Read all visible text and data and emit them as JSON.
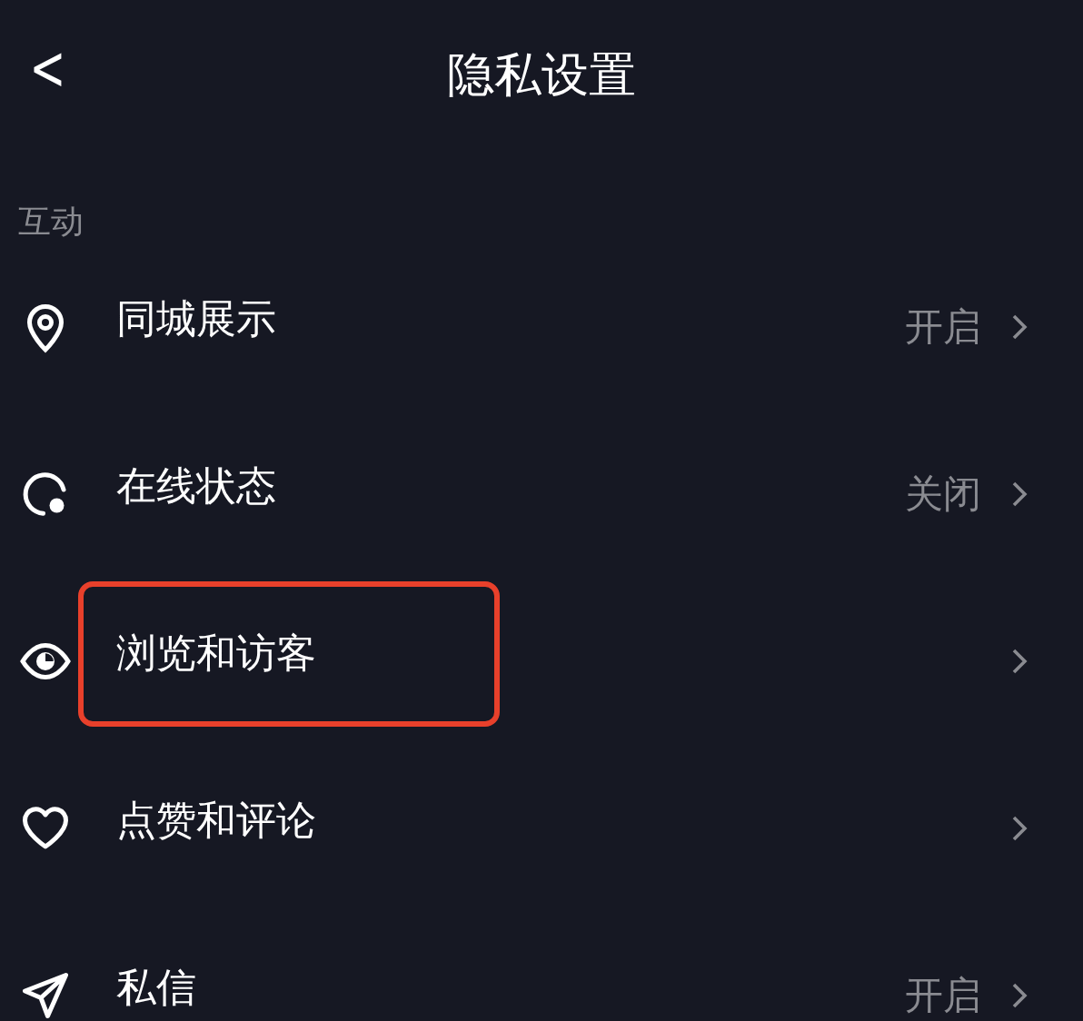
{
  "header": {
    "back": "<",
    "title": "隐私设置"
  },
  "section": {
    "label": "互动"
  },
  "items": [
    {
      "label": "同城展示",
      "value": "开启",
      "highlighted": false
    },
    {
      "label": "在线状态",
      "value": "关闭",
      "highlighted": false
    },
    {
      "label": "浏览和访客",
      "highlighted": true
    },
    {
      "label": "点赞和评论",
      "highlighted": false
    },
    {
      "label": "私信",
      "value": "开启",
      "highlighted": false
    }
  ]
}
